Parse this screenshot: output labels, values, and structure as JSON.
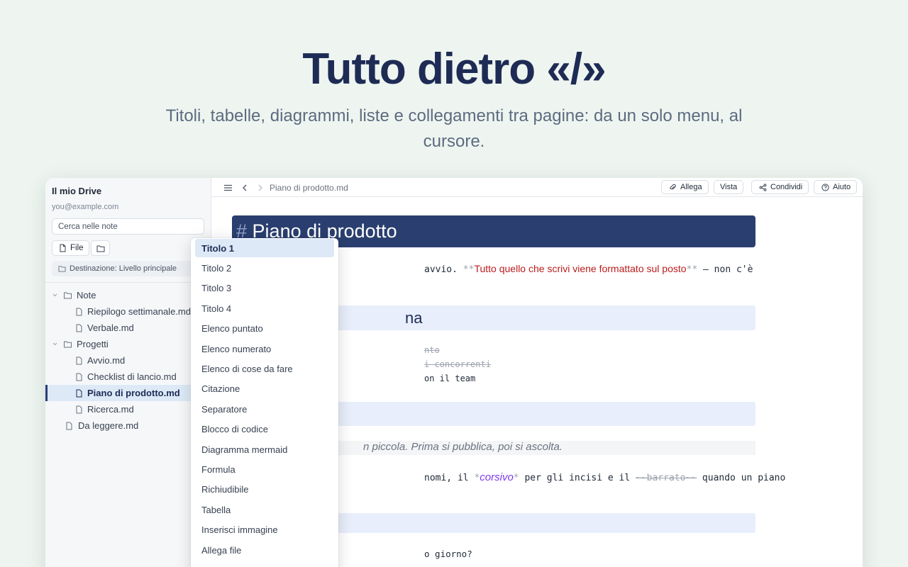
{
  "hero": {
    "title": "Tutto dietro «/»",
    "subtitle": "Titoli, tabelle, diagrammi, liste e collegamenti tra pagine: da un solo menu, al cursore."
  },
  "sidebar": {
    "title": "Il mio Drive",
    "email": "you@example.com",
    "search_placeholder": "Cerca nelle note",
    "file_button": "File",
    "destination": "Destinazione: Livello principale",
    "tree": [
      {
        "label": "Note",
        "type": "folder",
        "level": 0,
        "expanded": true
      },
      {
        "label": "Riepilogo settimanale.md",
        "type": "file",
        "level": 1
      },
      {
        "label": "Verbale.md",
        "type": "file",
        "level": 1
      },
      {
        "label": "Progetti",
        "type": "folder",
        "level": 0,
        "expanded": true
      },
      {
        "label": "Avvio.md",
        "type": "file",
        "level": 1
      },
      {
        "label": "Checklist di lancio.md",
        "type": "file",
        "level": 1
      },
      {
        "label": "Piano di prodotto.md",
        "type": "file",
        "level": 1,
        "active": true
      },
      {
        "label": "Ricerca.md",
        "type": "file",
        "level": 1
      },
      {
        "label": "Da leggere.md",
        "type": "file",
        "level": 0
      }
    ]
  },
  "topbar": {
    "breadcrumb": "Piano di prodotto.md",
    "buttons": [
      "Allega",
      "Vista",
      "Condividi",
      "Aiuto"
    ]
  },
  "editor": {
    "h1_hash": "#",
    "h1_text": "Piano di prodotto",
    "line1_prefix": "avvio.",
    "line1_stars_open": "**",
    "line1_bold": "Tutto quello che scrivi viene formattato sul posto",
    "line1_stars_close": "**",
    "line1_suffix": "— non c'è",
    "h2_partial": "na",
    "list_1": "nto",
    "list_2": "i concorrenti",
    "list_3": "on il team",
    "quote": "n piccola. Prima si pubblica, poi si ascolta.",
    "para_prefix": "nomi, il",
    "para_italic_mark_open": "*",
    "para_italic": "corsivo",
    "para_italic_mark_close": "*",
    "para_mid": "per gli incisi e il",
    "para_strike": "~~barrato~~",
    "para_suffix": "quando un piano",
    "q1": "o giorno?"
  },
  "slash_menu": {
    "items": [
      "Titolo 1",
      "Titolo 2",
      "Titolo 3",
      "Titolo 4",
      "Elenco puntato",
      "Elenco numerato",
      "Elenco di cose da fare",
      "Citazione",
      "Separatore",
      "Blocco di codice",
      "Diagramma mermaid",
      "Formula",
      "Richiudibile",
      "Tabella",
      "Inserisci immagine",
      "Allega file"
    ],
    "selected_index": 0
  },
  "colors": {
    "background": "#eef5f0",
    "brand_dark": "#1e2b55",
    "heading_bar": "#2a3f6f",
    "selection": "#dde9f7",
    "bold_red": "#b91c1c",
    "italic_purple": "#7c3aed"
  }
}
